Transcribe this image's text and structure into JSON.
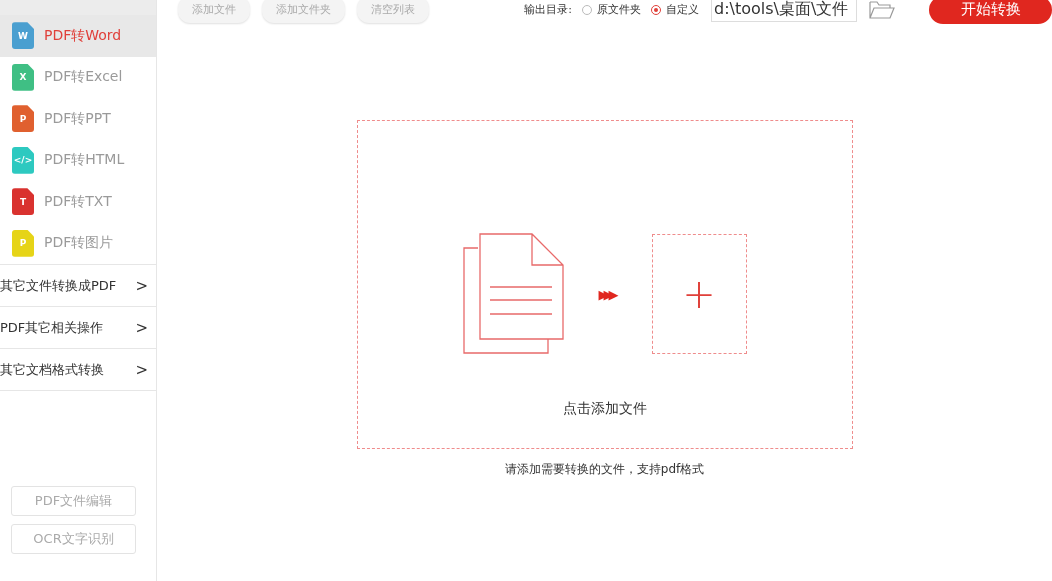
{
  "sidebar": {
    "items": [
      {
        "label": "PDF转Word",
        "kind": "word",
        "glyph": "W",
        "selected": true
      },
      {
        "label": "PDF转Excel",
        "kind": "excel",
        "glyph": "X",
        "selected": false
      },
      {
        "label": "PDF转PPT",
        "kind": "ppt",
        "glyph": "P",
        "selected": false
      },
      {
        "label": "PDF转HTML",
        "kind": "html",
        "glyph": "</>",
        "selected": false
      },
      {
        "label": "PDF转TXT",
        "kind": "txt",
        "glyph": "T",
        "selected": false
      },
      {
        "label": "PDF转图片",
        "kind": "image",
        "glyph": "P",
        "selected": false
      }
    ],
    "groups": [
      {
        "label": "其它文件转换成PDF",
        "chevron": ">"
      },
      {
        "label": "PDF其它相关操作",
        "chevron": ">"
      },
      {
        "label": "其它文档格式转换",
        "chevron": ">"
      }
    ],
    "bottom_buttons": [
      "PDF文件编辑",
      "OCR文字识别"
    ]
  },
  "toolbar": {
    "buttons": [
      "添加文件",
      "添加文件夹",
      "清空列表"
    ],
    "output": {
      "label": "输出目录:",
      "options": [
        {
          "label": "原文件夹",
          "selected": false
        },
        {
          "label": "自定义",
          "selected": true
        }
      ],
      "path": "d:\\tools\\桌面\\文件"
    },
    "start_button": "开始转换"
  },
  "dropzone": {
    "arrows": "▶▶▶",
    "plus": "+",
    "label": "点击添加文件",
    "hint": "请添加需要转换的文件，支持pdf格式"
  }
}
